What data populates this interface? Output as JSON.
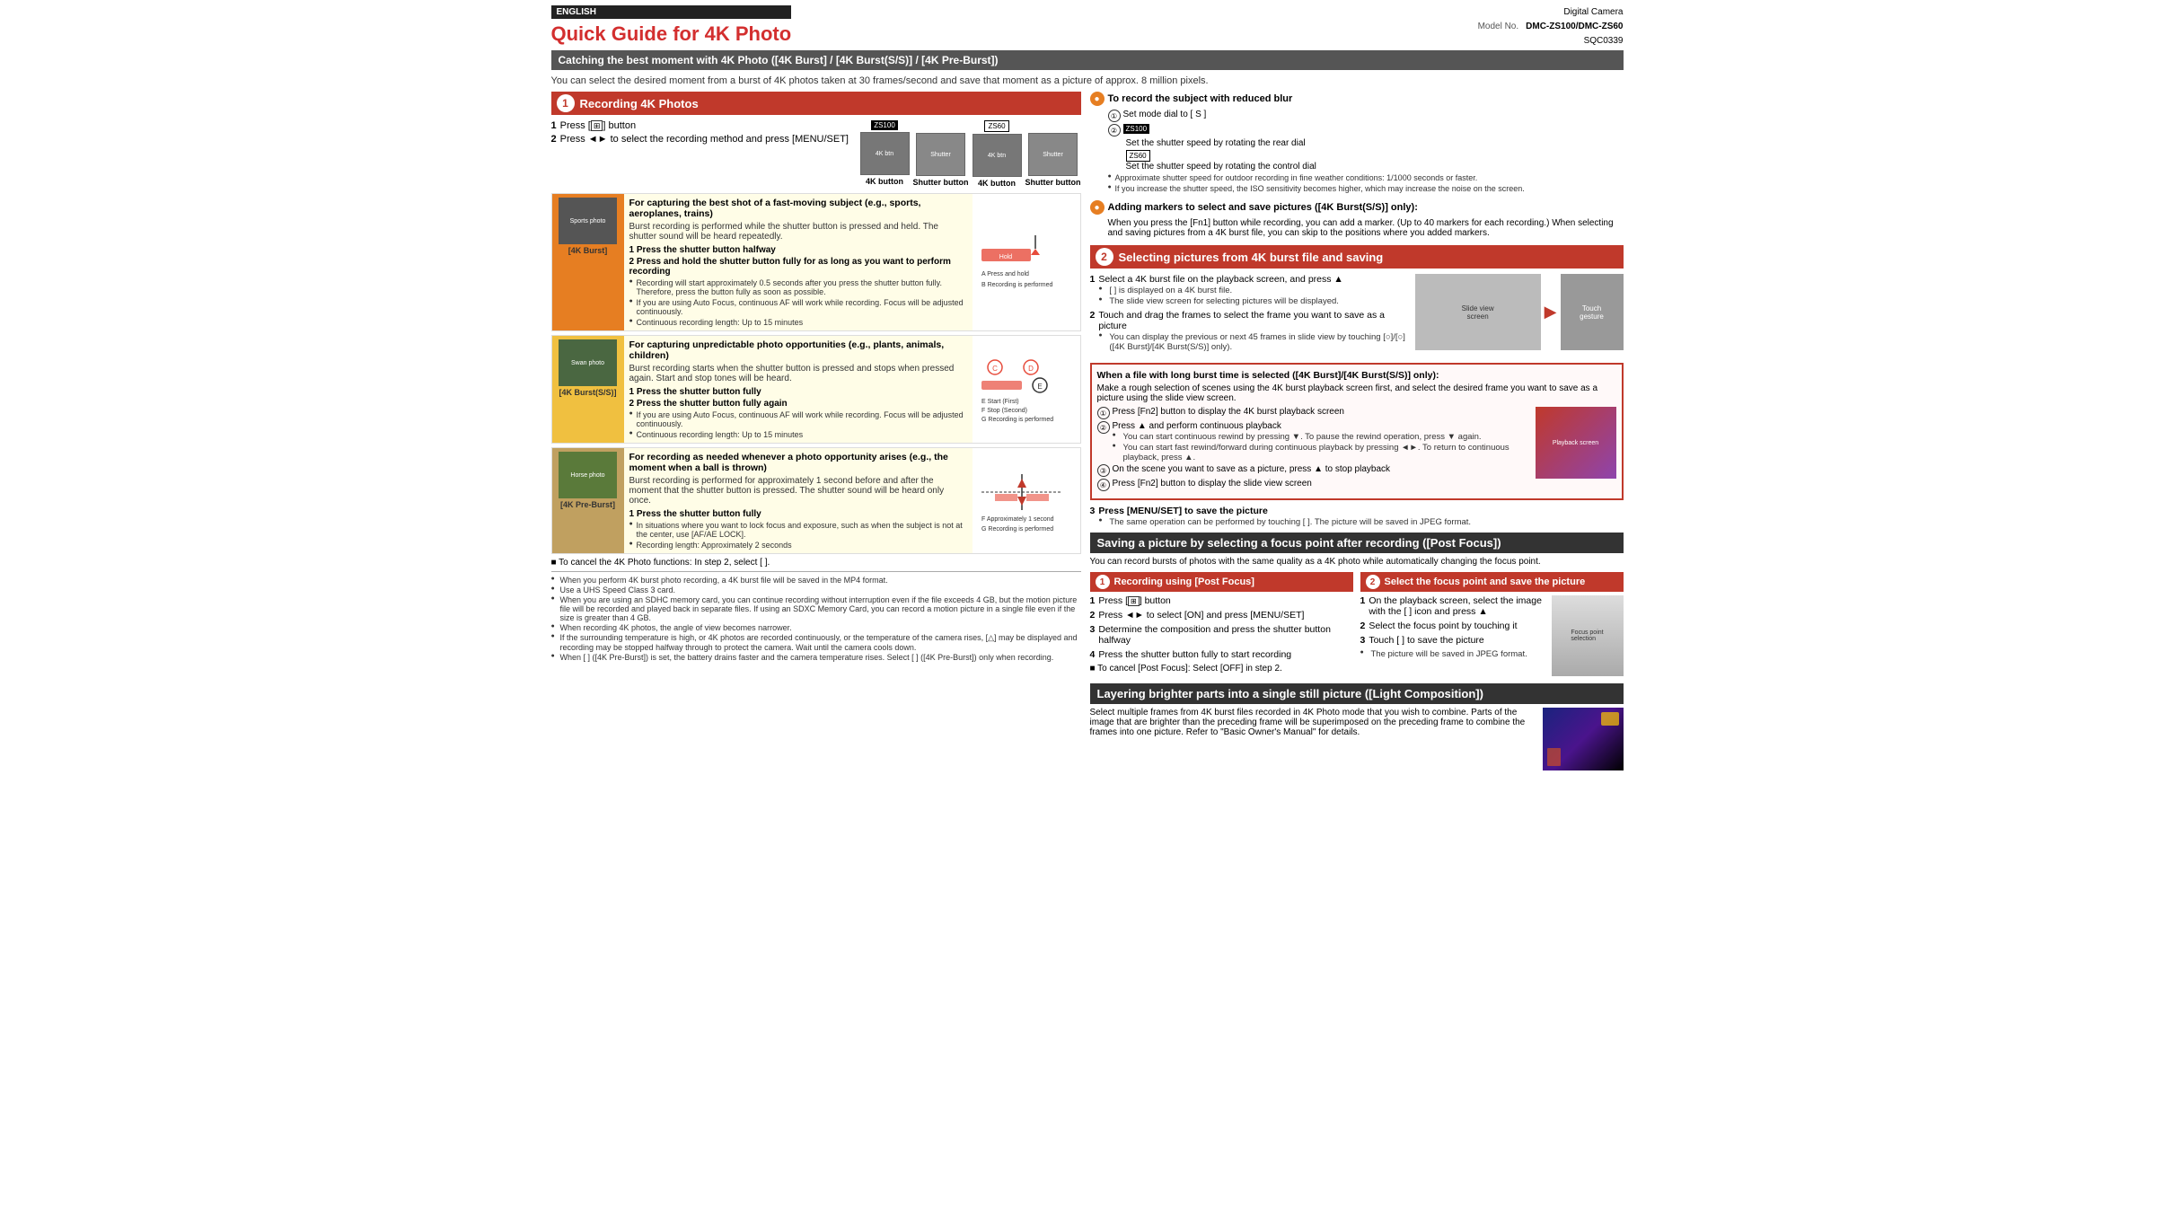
{
  "header": {
    "english_badge": "ENGLISH",
    "product_type": "Digital Camera",
    "model_label": "Model No.",
    "model_value": "DMC-ZS100/DMC-ZS60",
    "doc_number": "SQC0339",
    "title": "Quick Guide for 4K Photo"
  },
  "banner": {
    "title": "Catching the best moment with 4K Photo ([4K Burst] / [4K Burst(S/S)] / [4K Pre-Burst])",
    "description": "You can select the desired moment from a burst of 4K photos taken at 30 frames/second and save that moment as a picture of approx. 8 million pixels."
  },
  "section1": {
    "number": "1",
    "title": "Recording 4K Photos",
    "steps": [
      {
        "num": "1",
        "text": "Press [  ] button"
      },
      {
        "num": "2",
        "text": "Press ◄► to select the recording method and press [MENU/SET]"
      }
    ],
    "model_tags": {
      "zs100": "ZS100",
      "zs60": "ZS60"
    },
    "step_images": [
      {
        "label": "4K button",
        "tag": "ZS100"
      },
      {
        "label": "Shutter button",
        "tag": ""
      },
      {
        "label": "4K button",
        "tag": "ZS60"
      },
      {
        "label": "Shutter button",
        "tag": ""
      }
    ]
  },
  "burst_modes": [
    {
      "icon_label": "[4K Burst]",
      "icon_color": "#e67e22",
      "title": "For capturing the best shot of a fast-moving subject",
      "title_examples": "(e.g., sports, aeroplanes, trains)",
      "description": "Burst recording is performed while the shutter button is pressed and held. The shutter sound will be heard repeatedly.",
      "steps": [
        {
          "num": "1",
          "text": "Press the shutter button halfway"
        },
        {
          "num": "2",
          "text": "Press and hold the shutter button fully for as long as you want to perform recording"
        }
      ],
      "notes": [
        "Recording will start approximately 0.5 seconds after you press the shutter button fully. Therefore, press the button fully as soon as possible.",
        "If you are using Auto Focus, continuous AF will work while recording. Focus will be adjusted continuously.",
        "Continuous recording length: Up to 15 minutes"
      ],
      "diagram_labels": [
        "A Press and hold",
        "B Recording is performed"
      ]
    },
    {
      "icon_label": "[4K Burst(S/S)]",
      "icon_color": "#27ae60",
      "title": "For capturing unpredictable photo opportunities",
      "title_examples": "(e.g., plants, animals, children)",
      "description": "Burst recording starts when the shutter button is pressed and stops when pressed again. Start and stop tones will be heard.",
      "steps": [
        {
          "num": "1",
          "text": "Press the shutter button fully"
        },
        {
          "num": "2",
          "text": "Press the shutter button fully again"
        }
      ],
      "notes": [
        "If you are using Auto Focus, continuous AF will work while recording. Focus will be adjusted continuously.",
        "Continuous recording length: Up to 15 minutes"
      ],
      "diagram_labels": [
        "C",
        "D",
        "E Start (First)",
        "F Stop (Second)",
        "G Recording is performed"
      ]
    },
    {
      "icon_label": "[4K Pre-Burst]",
      "icon_color": "#8e44ad",
      "title": "For recording as needed whenever a photo opportunity arises",
      "title_examples": "(e.g., the moment when a ball is thrown)",
      "description": "Burst recording is performed for approximately 1 second before and after the moment that the shutter button is pressed. The shutter sound will be heard only once.",
      "steps": [
        {
          "num": "1",
          "text": "Press the shutter button fully"
        }
      ],
      "notes": [
        "In situations where you want to lock focus and exposure, such as when the subject is not at the center, use [AF/AE LOCK].",
        "Recording length: Approximately 2 seconds"
      ],
      "diagram_labels": [
        "F Approximately 1 second",
        "G Recording is performed"
      ]
    }
  ],
  "cancel_note": "■ To cancel the 4K Photo functions: In step 2, select [  ].",
  "footer_notes": [
    "When you perform 4K burst photo recording, a 4K burst file will be saved in the MP4 format.",
    "Use a UHS Speed Class 3 card.",
    "When you are using an SDHC memory card, you can continue recording without interruption even if the file exceeds 4 GB, but the motion picture file will be recorded and played back in separate files. If using an SDXC Memory Card, you can record a motion picture in a single file even if the size is greater than 4 GB.",
    "When recording 4K photos, the angle of view becomes narrower.",
    "If the surrounding temperature is high, or 4K photos are recorded continuously, or the temperature of the camera rises, [△] may be displayed and recording may be stopped halfway through to protect the camera. Wait until the camera cools down.",
    "When [  ] ([4K Pre-Burst]) is set, the battery drains faster and the camera temperature rises. Select [  ] ([4K Pre-Burst]) only when recording."
  ],
  "right_col": {
    "reduce_blur": {
      "title": "To record the subject with reduced blur",
      "steps": [
        {
          "num": "①",
          "text": "Set mode dial to [ S ]"
        },
        {
          "num": "②",
          "text": "ZS100",
          "tag": "zs100"
        }
      ],
      "zs100_steps": [
        "Set the shutter speed by rotating the rear dial"
      ],
      "zs60_tag": "ZS60",
      "zs60_step": "Set the shutter speed by rotating the control dial",
      "notes": [
        "Approximate shutter speed for outdoor recording in fine weather conditions: 1/1000 seconds or faster.",
        "If you increase the shutter speed, the ISO sensitivity becomes higher, which may increase the noise on the screen."
      ]
    },
    "adding_markers": {
      "title": "Adding markers to select and save pictures ([4K Burst(S/S)] only):",
      "description": "When you press the [Fn1] button while recording, you can add a marker. (Up to 40 markers for each recording.) When selecting and saving pictures from a 4K burst file, you can skip to the positions where you added markers."
    },
    "section2": {
      "number": "2",
      "title": "Selecting pictures from 4K burst file and saving",
      "steps": [
        {
          "num": "1",
          "text": "Select a 4K burst file on the playback screen, and press ▲",
          "notes": [
            "[  ] is displayed on a 4K burst file.",
            "The slide view screen for selecting pictures will be displayed."
          ]
        },
        {
          "num": "2",
          "text": "Touch and drag the frames to select the frame you want to save as a picture",
          "notes": [
            "You can display the previous or next 45 frames in slide view by touching [○]/[○] ([4K Burst]/[4K Burst(S/S)] only)."
          ]
        }
      ],
      "images_note": "Touch gesture images shown"
    },
    "long_burst_box": {
      "title": "When a file with long burst time is selected ([4K Burst]/[4K Burst(S/S)] only):",
      "description": "Make a rough selection of scenes using the 4K burst playback screen first, and select the desired frame you want to save as a picture using the slide view screen.",
      "steps": [
        {
          "num": "①",
          "text": "Press [Fn2] button to display the 4K burst playback screen"
        },
        {
          "num": "②",
          "text": "Press ▲ and perform continuous playback",
          "notes": [
            "You can start continuous rewind by pressing ▼. To pause the rewind operation, press ▼ again.",
            "You can start fast rewind/forward during continuous playback by pressing ◄►. To return to continuous playback, press ▲."
          ]
        },
        {
          "num": "③",
          "text": "On the scene you want to save as a picture, press ▲ to stop playback"
        },
        {
          "num": "④",
          "text": "Press [Fn2] button to display the slide view screen"
        }
      ]
    },
    "save_step": {
      "num": "3",
      "text": "Press [MENU/SET] to save the picture",
      "note": "The same operation can be performed by touching [  ]. The picture will be saved in JPEG format."
    },
    "post_focus": {
      "title": "Saving a picture by selecting a focus point after recording ([Post Focus])",
      "description": "You can record bursts of photos with the same quality as a 4K photo while automatically changing the focus point.",
      "section1_title": "Recording using [Post Focus]",
      "section1_number": "1",
      "section1_steps": [
        {
          "num": "1",
          "text": "Press [  ] button"
        },
        {
          "num": "2",
          "text": "Press ◄► to select [ON] and press [MENU/SET]"
        },
        {
          "num": "3",
          "text": "Determine the composition and press the shutter button halfway"
        },
        {
          "num": "4",
          "text": "Press the shutter button fully to start recording"
        }
      ],
      "section1_cancel": "■ To cancel [Post Focus]: Select [OFF] in step 2.",
      "section2_title": "Select the focus point and save the picture",
      "section2_number": "2",
      "section2_steps": [
        {
          "num": "1",
          "text": "On the playback screen, select the image with the [  ] icon and press ▲"
        },
        {
          "num": "2",
          "text": "Select the focus point by touching it"
        },
        {
          "num": "3",
          "text": "Touch [  ] to save the picture"
        }
      ],
      "section2_note": "The picture will be saved in JPEG format."
    },
    "light_composition": {
      "title": "Layering brighter parts into a single still picture ([Light Composition])",
      "description": "Select multiple frames from 4K burst files recorded in 4K Photo mode that you wish to combine. Parts of the image that are brighter than the preceding frame will be superimposed on the preceding frame to combine the frames into one picture. Refer to \"Basic Owner's Manual\" for details."
    }
  }
}
